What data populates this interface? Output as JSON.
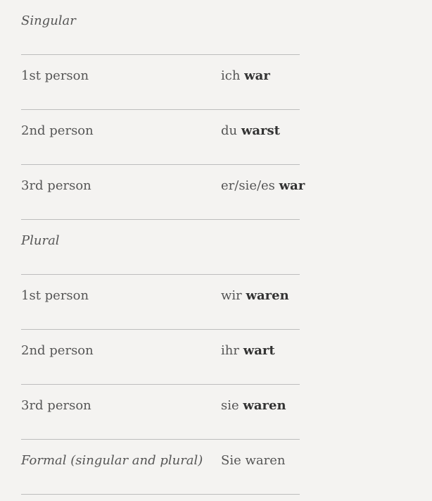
{
  "singular": {
    "heading": "Singular",
    "rows": [
      {
        "person": "1st person",
        "pronoun": "ich",
        "verb": "war"
      },
      {
        "person": "2nd person",
        "pronoun": "du",
        "verb": "warst"
      },
      {
        "person": "3rd person",
        "pronoun": "er/sie/es",
        "verb": "war"
      }
    ]
  },
  "plural": {
    "heading": "Plural",
    "rows": [
      {
        "person": "1st person",
        "pronoun": "wir",
        "verb": "waren"
      },
      {
        "person": "2nd person",
        "pronoun": "ihr",
        "verb": "wart"
      },
      {
        "person": "3rd person",
        "pronoun": "sie",
        "verb": "waren"
      }
    ]
  },
  "formal": {
    "label": "Formal (singular and plural)",
    "form": "Sie waren"
  }
}
